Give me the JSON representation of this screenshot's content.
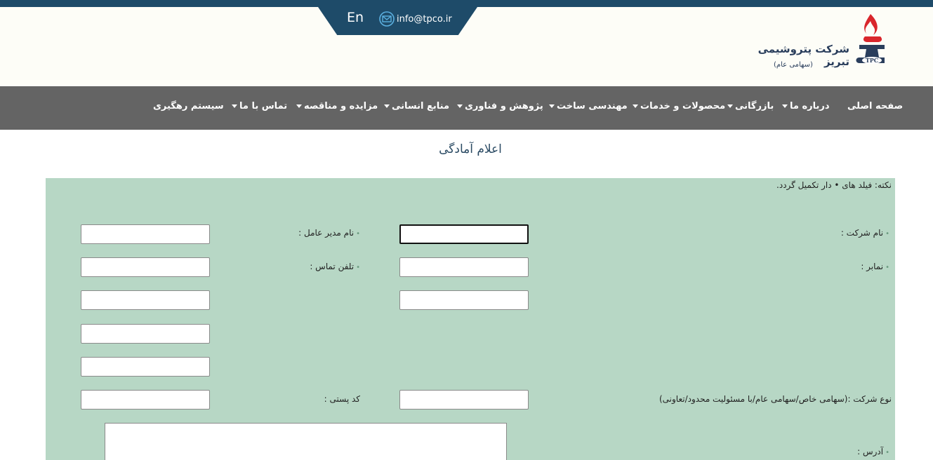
{
  "header": {
    "lang": "En",
    "email": "info@tpco.ir",
    "company_name": "شرکت پتروشیمی تبریز",
    "company_sub": "(سهامی عام)",
    "logo_text": "TPC"
  },
  "nav": {
    "home": "صفحه اصلی",
    "about": "درباره ما",
    "commerce": "بازرگانی",
    "products": "محصولات و خدمات",
    "construction": "مهندسی ساخت",
    "research": "پژوهش و فناوری",
    "hr": "منابع انسانی",
    "tenders": "مزایده و مناقصه",
    "contact": "تماس با ما",
    "tracking": "سیستم رهگیری"
  },
  "page": {
    "title": "اعلام آمادگی",
    "note": "نکته: فیلد های • دار تکمیل گردد."
  },
  "form": {
    "company_name_label": "نام شرکت :",
    "ceo_label": "نام مدیر عامل :",
    "fax_label": "نمابر :",
    "phone_label": "تلفن تماس :",
    "company_type_label": "نوع شرکت :(سهامی خاص/سهامی عام/با مسئولیت محدود/تعاونی)",
    "postal_label": "کد پستی :",
    "address_label": "آدرس :",
    "bullet": "•"
  }
}
